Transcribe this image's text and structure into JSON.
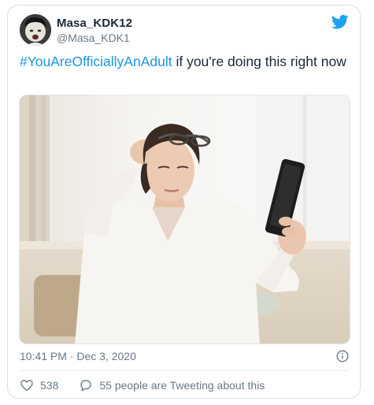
{
  "author": {
    "display_name": "Masa_KDK12",
    "handle": "@Masa_KDK1",
    "avatar_icon": "crying-child-avatar"
  },
  "tweet": {
    "hashtag": "#YouAreOfficiallyAnAdult",
    "text": " if you're doing this right now"
  },
  "media": {
    "icon": "woman-squinting-at-phone-photo"
  },
  "meta": {
    "timestamp": "10:41 PM · Dec 3, 2020",
    "info_icon": "info-icon"
  },
  "actions": {
    "like_count": "538",
    "like_icon": "heart-icon",
    "conversation_text": "55 people are Tweeting about this",
    "conversation_icon": "speech-bubble-icon"
  },
  "colors": {
    "brand": "#1da1f2",
    "hashtag": "#1b95e0",
    "text": "#1c2938",
    "muted": "#6a7986",
    "border": "#d9dfe5"
  }
}
